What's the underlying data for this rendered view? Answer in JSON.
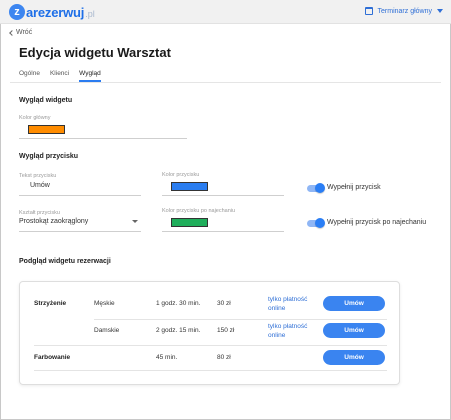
{
  "header": {
    "logo_letter": "z",
    "logo_text": "arezerwuj",
    "logo_tld": ".pl",
    "calendar_label": "Terminarz główny",
    "accent_color": "#2f6fd6"
  },
  "nav": {
    "back_label": "Wróć"
  },
  "page": {
    "title": "Edycja widgetu Warsztat"
  },
  "tabs": [
    {
      "label": "Ogólne",
      "active": false
    },
    {
      "label": "Klienci",
      "active": false
    },
    {
      "label": "Wygląd",
      "active": true
    }
  ],
  "widget_look": {
    "section_title": "Wygląd widgetu",
    "main_color_label": "Kolor główny",
    "main_color": "#ff8c00"
  },
  "button_look": {
    "section_title": "Wygląd przycisku",
    "button_text_label": "Tekst przycisku",
    "button_text_value": "Umów",
    "button_color_label": "Kolor przycisku",
    "button_color": "#2a7df0",
    "fill_button_label": "Wypełnij przycisk",
    "fill_button_on": true,
    "shape_label": "Kształt przycisku",
    "shape_value": "Prostokąt zaokrąglony",
    "hover_color_label": "Kolor przycisku po najechaniu",
    "hover_color": "#1fae5b",
    "fill_hover_label": "Wypełnij przycisk po najechaniu",
    "fill_hover_on": true
  },
  "preview": {
    "section_title": "Podgląd widgetu rezerwacji",
    "rows": [
      {
        "service": "Strzyżenie",
        "variant": "Męskie",
        "duration": "1 godz. 30 min.",
        "price": "30 zł",
        "payment_line1": "tylko płatność",
        "payment_line2": "online",
        "button": "Umów"
      },
      {
        "service": "",
        "variant": "Damskie",
        "duration": "2 godz. 15 min.",
        "price": "150 zł",
        "payment_line1": "tylko płatność",
        "payment_line2": "online",
        "button": "Umów"
      },
      {
        "service": "Farbowanie",
        "variant": "",
        "duration": "45 min.",
        "price": "80 zł",
        "payment_line1": "",
        "payment_line2": "",
        "button": "Umów"
      }
    ]
  }
}
